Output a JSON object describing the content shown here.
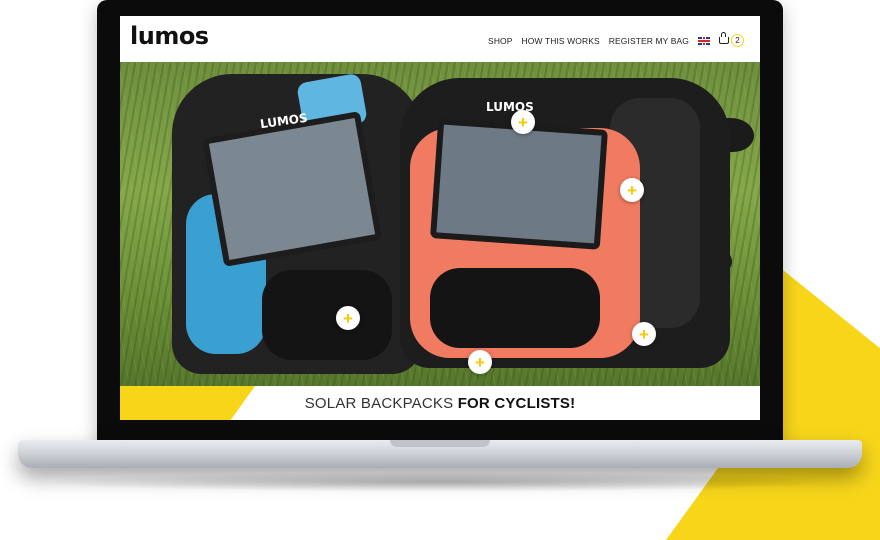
{
  "site": {
    "logo_text": "lumos",
    "nav": {
      "items": [
        "SHOP",
        "HOW THIS WORKS",
        "REGISTER MY BAG"
      ],
      "language_icon": "uk-flag-icon",
      "cart": {
        "icon": "basket-icon",
        "count": "2"
      }
    },
    "hero": {
      "bag_brand_left": "LUMOS",
      "bag_brand_right": "LUMOS",
      "hotspot_symbol": "+"
    },
    "tagline": {
      "light": "SOLAR BACKPACKS ",
      "bold": "FOR CYCLISTS!"
    }
  },
  "colors": {
    "accent": "#f7d61a",
    "laptop_bezel": "#0b0b0b",
    "bag_blue": "#3aa0d2",
    "bag_coral": "#f07b61"
  }
}
